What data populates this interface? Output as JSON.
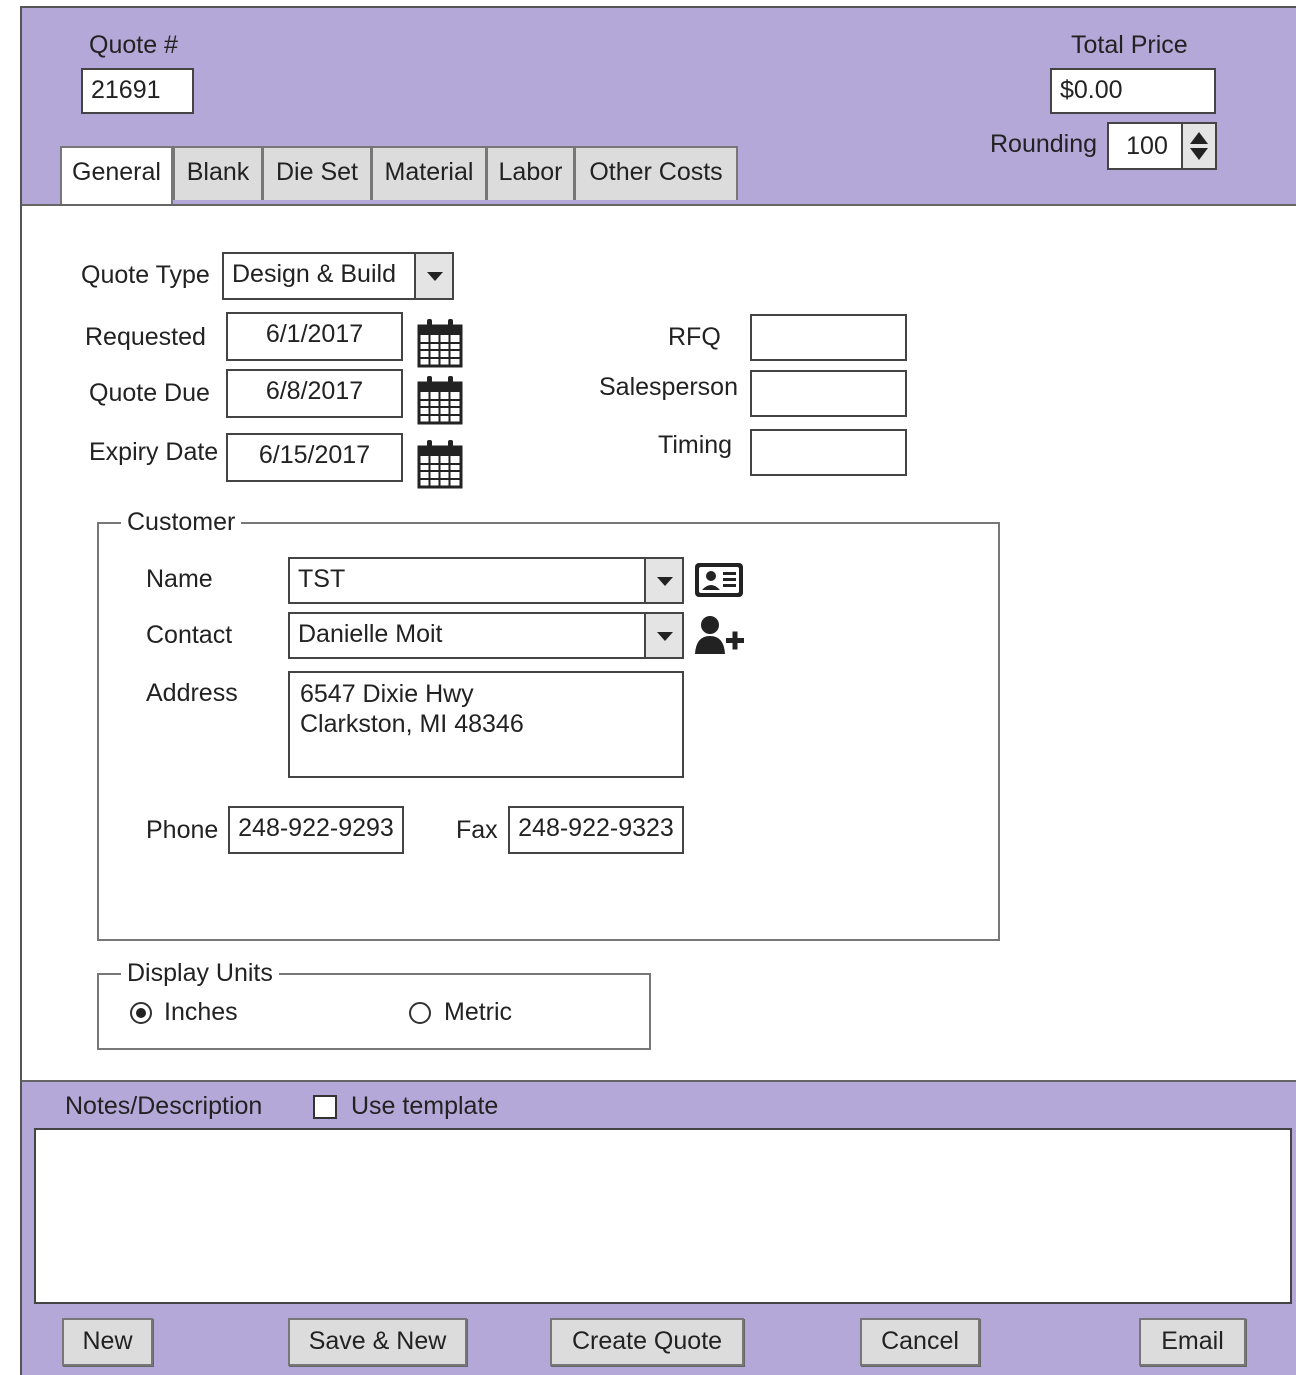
{
  "header": {
    "quote_label": "Quote #",
    "quote_number": "21691",
    "total_label": "Total Price",
    "total_value": "$0.00",
    "rounding_label": "Rounding",
    "rounding_value": "100"
  },
  "tabs": [
    {
      "label": "General",
      "active": true
    },
    {
      "label": "Blank",
      "active": false
    },
    {
      "label": "Die Set",
      "active": false
    },
    {
      "label": "Material",
      "active": false
    },
    {
      "label": "Labor",
      "active": false
    },
    {
      "label": "Other Costs",
      "active": false
    }
  ],
  "general": {
    "quote_type_label": "Quote Type",
    "quote_type_value": "Design & Build",
    "requested_label": "Requested",
    "requested_value": "6/1/2017",
    "quote_due_label": "Quote Due",
    "quote_due_value": "6/8/2017",
    "expiry_label": "Expiry Date",
    "expiry_value": "6/15/2017",
    "rfq_label": "RFQ",
    "rfq_value": "",
    "salesperson_label": "Salesperson",
    "salesperson_value": "",
    "timing_label": "Timing",
    "timing_value": ""
  },
  "customer": {
    "legend": "Customer",
    "name_label": "Name",
    "name_value": "TST",
    "contact_label": "Contact",
    "contact_value": "Danielle Moit",
    "address_label": "Address",
    "address_line1": "6547 Dixie Hwy",
    "address_line2": "Clarkston, MI 48346",
    "phone_label": "Phone",
    "phone_value": "248-922-9293",
    "fax_label": "Fax",
    "fax_value": "248-922-9323"
  },
  "units": {
    "legend": "Display Units",
    "inches_label": "Inches",
    "metric_label": "Metric",
    "selected": "Inches"
  },
  "notes": {
    "label": "Notes/Description",
    "template_label": "Use template",
    "template_checked": false,
    "value": ""
  },
  "buttons": {
    "new": "New",
    "save_new": "Save & New",
    "create": "Create Quote",
    "cancel": "Cancel",
    "email": "Email"
  },
  "icons": {
    "calendar": "calendar-icon",
    "contact_card": "contact-card-icon",
    "add_user": "add-user-icon",
    "dropdown": "chevron-down-icon",
    "spinner": "spinner-icon"
  },
  "colors": {
    "header_bg": "#b3a8d7",
    "button_bg": "#dcdcdc"
  }
}
